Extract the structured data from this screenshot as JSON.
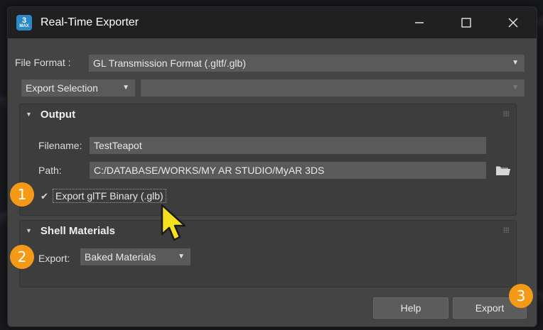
{
  "window": {
    "title": "Real-Time Exporter",
    "icon_text": "3",
    "icon_sub": "MAX"
  },
  "file_format": {
    "label": "File Format :",
    "value": "GL Transmission Format (.gltf/.glb)"
  },
  "selection": {
    "value": "Export Selection",
    "secondary_value": ""
  },
  "output": {
    "title": "Output",
    "filename_label": "Filename:",
    "filename_value": "TestTeapot",
    "path_label": "Path:",
    "path_value": "C:/DATABASE/WORKS/MY AR STUDIO/MyAR 3DS",
    "binary_checkbox_label": "Export glTF Binary (.glb)",
    "binary_checked": true
  },
  "shell_materials": {
    "title": "Shell Materials",
    "export_label": "Export:",
    "export_value": "Baked Materials"
  },
  "buttons": {
    "help": "Help",
    "export": "Export"
  },
  "badges": {
    "one": "1",
    "two": "2",
    "three": "3"
  },
  "icons": {
    "checkmark": "✔",
    "dropdown": "▼",
    "collapse": "▼"
  },
  "colors": {
    "badge": "#f59a17",
    "titlebar": "#202020",
    "window_bg": "#444444",
    "cursor_fill": "#f5e11d"
  }
}
